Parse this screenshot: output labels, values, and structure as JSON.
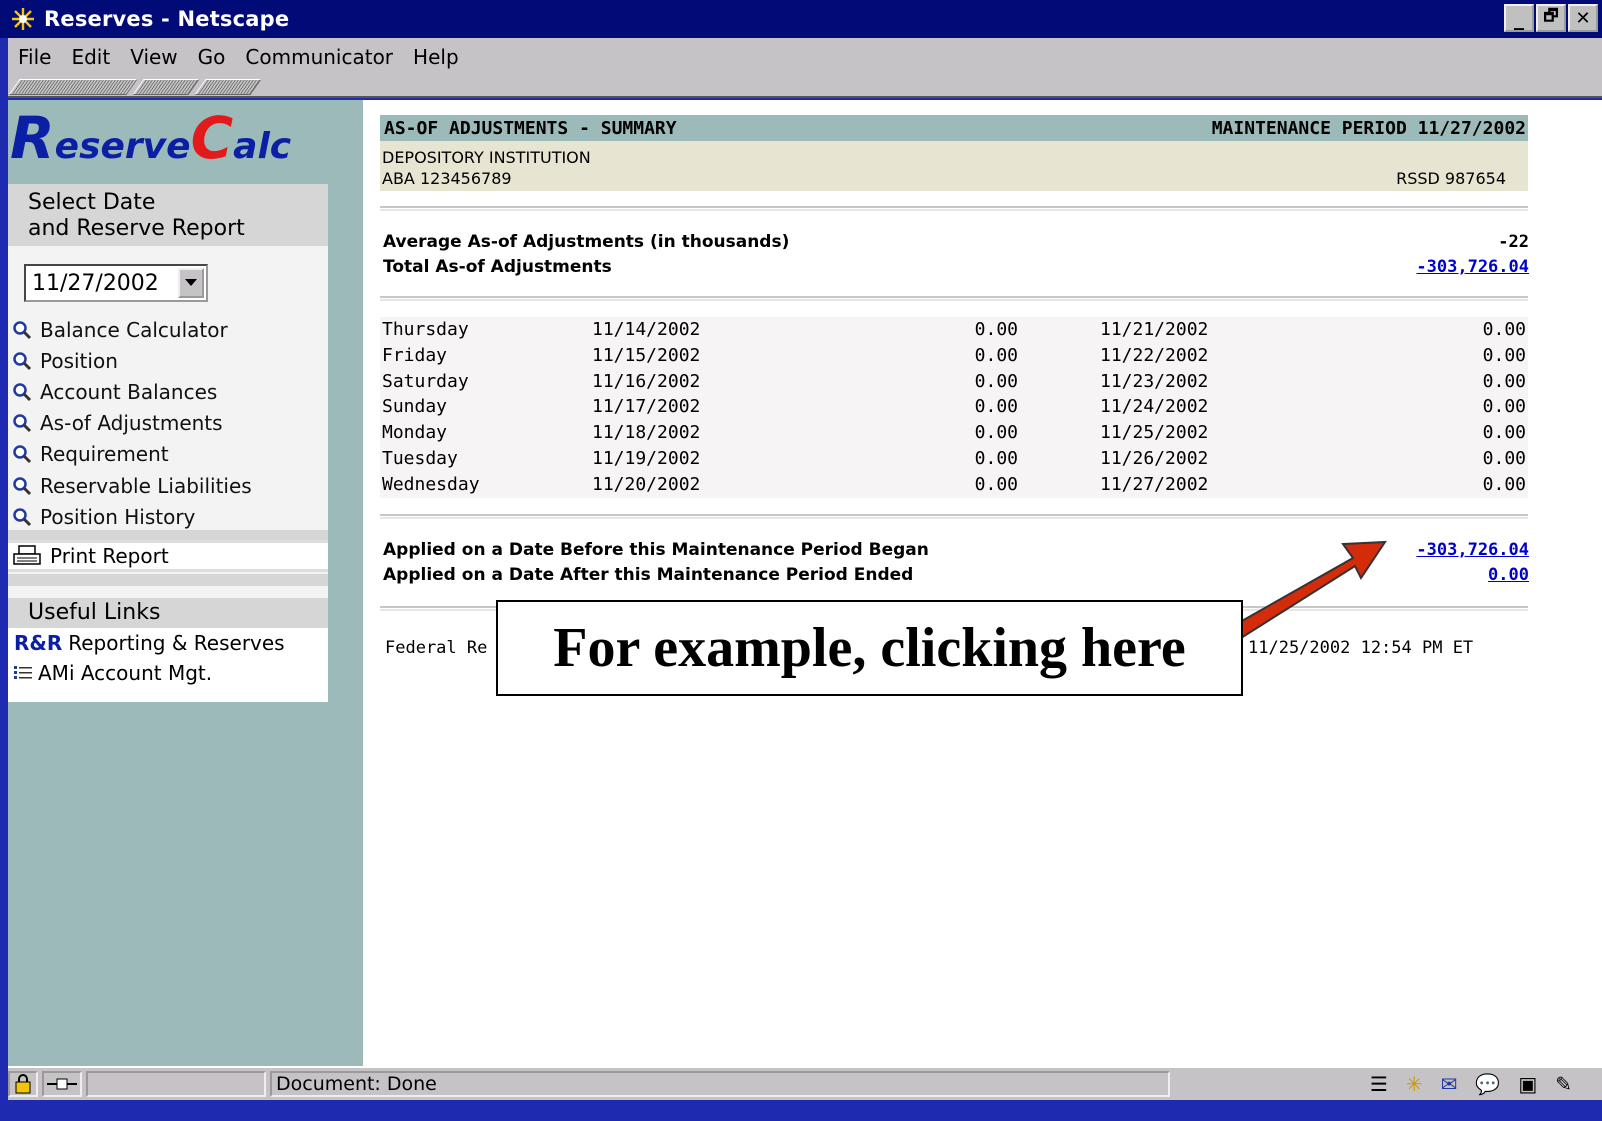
{
  "window": {
    "title": "Reserves - Netscape",
    "min": "_",
    "max": "🗗",
    "close": "✕"
  },
  "menu": [
    "File",
    "Edit",
    "View",
    "Go",
    "Communicator",
    "Help"
  ],
  "sidebar": {
    "logo_r": "R",
    "logo_eserve": "eserve",
    "logo_c": "C",
    "logo_alc": "alc",
    "select_head_1": "Select Date",
    "select_head_2": "and Reserve Report",
    "date_value": "11/27/2002",
    "nav": [
      "Balance Calculator",
      "Position",
      "Account Balances",
      "As-of Adjustments",
      "Requirement",
      "Reservable Liabilities",
      "Position History"
    ],
    "print_label": "Print Report",
    "links_head": "Useful Links",
    "link1_badge": "R&R",
    "link1_label": "Reporting & Reserves",
    "link2_label": "AMi Account Mgt."
  },
  "report": {
    "header_left": "AS-OF ADJUSTMENTS - SUMMARY",
    "header_right": "MAINTENANCE PERIOD 11/27/2002",
    "institution": "DEPOSITORY INSTITUTION",
    "aba": "ABA 123456789",
    "rssd": "RSSD 987654",
    "avg_label": "Average As-of Adjustments (in thousands)",
    "avg_value": "-22",
    "total_label": "Total As-of Adjustments",
    "total_value": "-303,726.04",
    "days": [
      {
        "day": "Thursday",
        "date1": "11/14/2002",
        "v1": "0.00",
        "date2": "11/21/2002",
        "v2": "0.00"
      },
      {
        "day": "Friday",
        "date1": "11/15/2002",
        "v1": "0.00",
        "date2": "11/22/2002",
        "v2": "0.00"
      },
      {
        "day": "Saturday",
        "date1": "11/16/2002",
        "v1": "0.00",
        "date2": "11/23/2002",
        "v2": "0.00"
      },
      {
        "day": "Sunday",
        "date1": "11/17/2002",
        "v1": "0.00",
        "date2": "11/24/2002",
        "v2": "0.00"
      },
      {
        "day": "Monday",
        "date1": "11/18/2002",
        "v1": "0.00",
        "date2": "11/25/2002",
        "v2": "0.00"
      },
      {
        "day": "Tuesday",
        "date1": "11/19/2002",
        "v1": "0.00",
        "date2": "11/26/2002",
        "v2": "0.00"
      },
      {
        "day": "Wednesday",
        "date1": "11/20/2002",
        "v1": "0.00",
        "date2": "11/27/2002",
        "v2": "0.00"
      }
    ],
    "before_label": "Applied on a Date Before this Maintenance Period Began",
    "before_value": "-303,726.04",
    "after_label": "Applied on a Date After this Maintenance Period Ended",
    "after_value": "0.00",
    "footer_left": "Federal Re",
    "footer_right": "11/25/2002 12:54 PM ET"
  },
  "callout": "For example, clicking here",
  "status": {
    "text": "Document: Done"
  },
  "colors": {
    "accent_red": "#d42b0a",
    "link_blue": "#0000cc",
    "header_teal": "#9cbab9"
  }
}
